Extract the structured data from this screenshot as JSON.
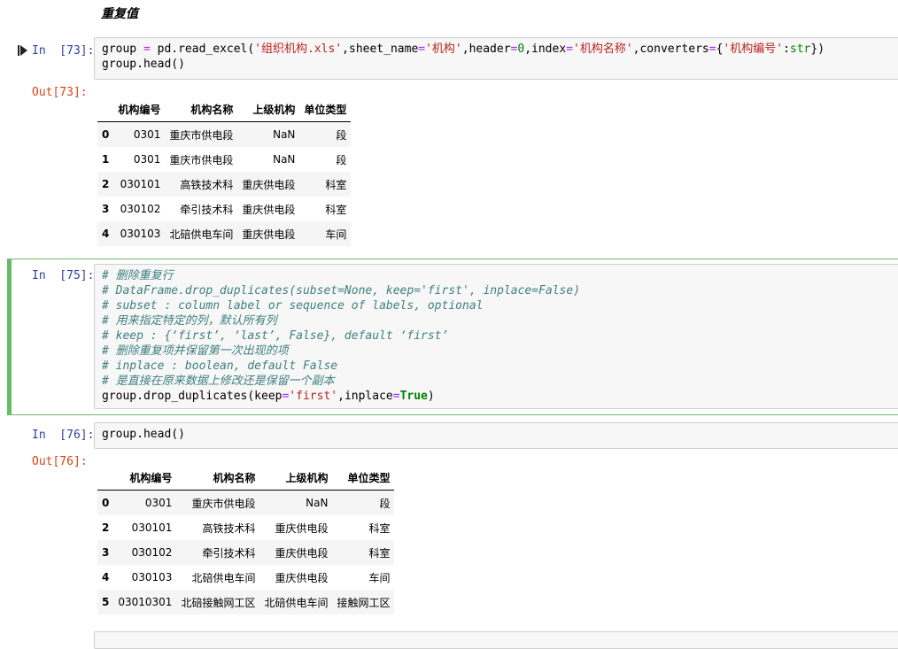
{
  "heading": "重复值",
  "cells": [
    {
      "in_prompt": "In  [73]:",
      "out_prompt": "Out[73]:",
      "code_lines": [
        [
          {
            "t": "group ",
            "c": ""
          },
          {
            "t": "=",
            "c": "op"
          },
          {
            "t": " pd.read_excel(",
            "c": ""
          },
          {
            "t": "'组织机构.xls'",
            "c": "str"
          },
          {
            "t": ",sheet_name",
            "c": ""
          },
          {
            "t": "=",
            "c": "op"
          },
          {
            "t": "'机构'",
            "c": "str"
          },
          {
            "t": ",header",
            "c": ""
          },
          {
            "t": "=",
            "c": "op"
          },
          {
            "t": "0",
            "c": "num"
          },
          {
            "t": ",index",
            "c": ""
          },
          {
            "t": "=",
            "c": "op"
          },
          {
            "t": "'机构名称'",
            "c": "str"
          },
          {
            "t": ",converters",
            "c": ""
          },
          {
            "t": "=",
            "c": "op"
          },
          {
            "t": "{",
            "c": ""
          },
          {
            "t": "'机构编号'",
            "c": "str"
          },
          {
            "t": ":",
            "c": ""
          },
          {
            "t": "str",
            "c": "num"
          },
          {
            "t": "})",
            "c": ""
          }
        ],
        [
          {
            "t": "group.head()",
            "c": ""
          }
        ]
      ],
      "table": {
        "headers": [
          "",
          "机构编号",
          "机构名称",
          "上级机构",
          "单位类型"
        ],
        "rows": [
          [
            "0",
            "0301",
            "重庆市供电段",
            "NaN",
            "段"
          ],
          [
            "1",
            "0301",
            "重庆市供电段",
            "NaN",
            "段"
          ],
          [
            "2",
            "030101",
            "高铁技术科",
            "重庆供电段",
            "科室"
          ],
          [
            "3",
            "030102",
            "牵引技术科",
            "重庆供电段",
            "科室"
          ],
          [
            "4",
            "030103",
            "北碚供电车间",
            "重庆供电段",
            "车间"
          ]
        ]
      }
    },
    {
      "in_prompt": "In  [75]:",
      "code_lines": [
        [
          {
            "t": "# 删除重复行",
            "c": "com"
          }
        ],
        [
          {
            "t": "# DataFrame.drop_duplicates(subset=None, keep='first', inplace=False)",
            "c": "com"
          }
        ],
        [
          {
            "t": "# subset : column label or sequence of labels, optional",
            "c": "com"
          }
        ],
        [
          {
            "t": "# 用来指定特定的列，默认所有列",
            "c": "com"
          }
        ],
        [
          {
            "t": "# keep : {‘first’, ‘last’, False}, default ‘first’",
            "c": "com"
          }
        ],
        [
          {
            "t": "# 删除重复项并保留第一次出现的项",
            "c": "com"
          }
        ],
        [
          {
            "t": "# inplace : boolean, default False",
            "c": "com"
          }
        ],
        [
          {
            "t": "# 是直接在原来数据上修改还是保留一个副本",
            "c": "com"
          }
        ],
        [
          {
            "t": "group.drop_duplicates(keep",
            "c": ""
          },
          {
            "t": "=",
            "c": "op"
          },
          {
            "t": "'first'",
            "c": "str"
          },
          {
            "t": ",inplace",
            "c": ""
          },
          {
            "t": "=",
            "c": "op"
          },
          {
            "t": "True",
            "c": "kw"
          },
          {
            "t": ")",
            "c": ""
          }
        ]
      ]
    },
    {
      "in_prompt": "In  [76]:",
      "out_prompt": "Out[76]:",
      "code_lines": [
        [
          {
            "t": "group.head()",
            "c": ""
          }
        ]
      ],
      "table": {
        "headers": [
          "",
          "机构编号",
          "机构名称",
          "上级机构",
          "单位类型"
        ],
        "rows": [
          [
            "0",
            "0301",
            "重庆市供电段",
            "NaN",
            "段"
          ],
          [
            "2",
            "030101",
            "高铁技术科",
            "重庆供电段",
            "科室"
          ],
          [
            "3",
            "030102",
            "牵引技术科",
            "重庆供电段",
            "科室"
          ],
          [
            "4",
            "030103",
            "北碚供电车间",
            "重庆供电段",
            "车间"
          ],
          [
            "5",
            "03010301",
            "北碚接触网工区",
            "北碚供电车间",
            "接触网工区"
          ]
        ]
      }
    }
  ],
  "colors": {
    "prompt_in": "#303f9f",
    "prompt_out": "#d84315",
    "selected_border": "#66bb6a"
  },
  "icons": {
    "run": "run-cell-icon"
  }
}
